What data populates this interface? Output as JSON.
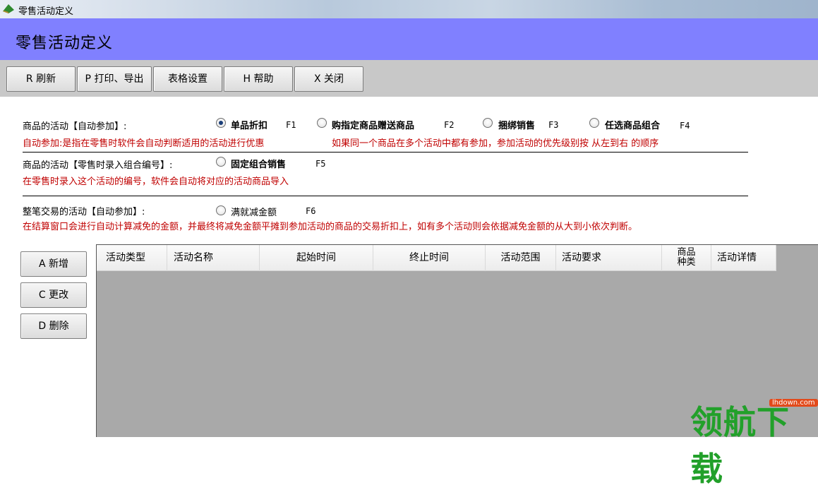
{
  "window": {
    "title": "零售活动定义",
    "ghost": ""
  },
  "header": {
    "title": "零售活动定义"
  },
  "toolbar": {
    "refresh": "R 刷新",
    "print_export": "P 打印、导出",
    "table_settings": "表格设置",
    "help": "H 帮助",
    "close": "X 关闭"
  },
  "section_auto": {
    "label": "商品的活动【自动参加】:",
    "options": [
      {
        "label": "单品折扣",
        "key": "F1",
        "checked": true
      },
      {
        "label": "购指定商品赠送商品",
        "key": "F2",
        "checked": false
      },
      {
        "label": "捆绑销售",
        "key": "F3",
        "checked": false
      },
      {
        "label": "任选商品组合",
        "key": "F4",
        "checked": false
      }
    ],
    "note1": "自动参加:是指在零售时软件会自动判断适用的活动进行优惠",
    "note2": "如果同一个商品在多个活动中都有参加，参加活动的优先级别按 从左到右 的顺序"
  },
  "section_code": {
    "label": "商品的活动【零售时录入组合编号】:",
    "option": {
      "label": "固定组合销售",
      "key": "F5",
      "checked": false
    },
    "note": "在零售时录入这个活动的编号，软件会自动将对应的活动商品导入"
  },
  "section_trade": {
    "label": "整笔交易的活动【自动参加】:",
    "option": {
      "label": "满就减金额",
      "key": "F6",
      "checked": false
    },
    "note": "在结算窗口会进行自动计算减免的金额，并最终将减免金额平摊到参加活动的商品的交易折扣上，如有多个活动则会依据减免金额的从大到小依次判断。"
  },
  "side_buttons": {
    "add": "A 新增",
    "edit": "C 更改",
    "delete": "D 删除"
  },
  "table": {
    "columns": [
      "活动类型",
      "活动名称",
      "起始时间",
      "终止时间",
      "活动范围",
      "活动要求",
      "商品\n种类",
      "活动详情"
    ],
    "col6_line1": "商品",
    "col6_line2": "种类",
    "rows": []
  },
  "watermark": {
    "text": "领航下载",
    "url": "lhdown.com"
  },
  "colors": {
    "header_bg": "#8080ff",
    "toolbar_bg": "#c8c8c8",
    "note_red": "#c00000",
    "grid_bg": "#a9a9a9"
  }
}
